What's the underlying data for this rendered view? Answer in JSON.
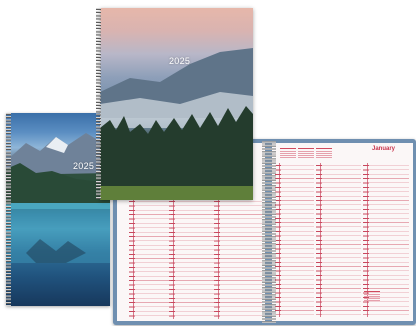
{
  "products": {
    "blue_calendar": {
      "year": "2025",
      "icon": "mountain-lake-photo"
    },
    "pink_calendar": {
      "year": "2025",
      "icon": "misty-forest-photo"
    },
    "open_planner": {
      "month": "January"
    }
  },
  "colors": {
    "cover_blue": "#6f8fb0",
    "planner_red": "#c8344c",
    "page_bg": "#fbf7f7"
  }
}
